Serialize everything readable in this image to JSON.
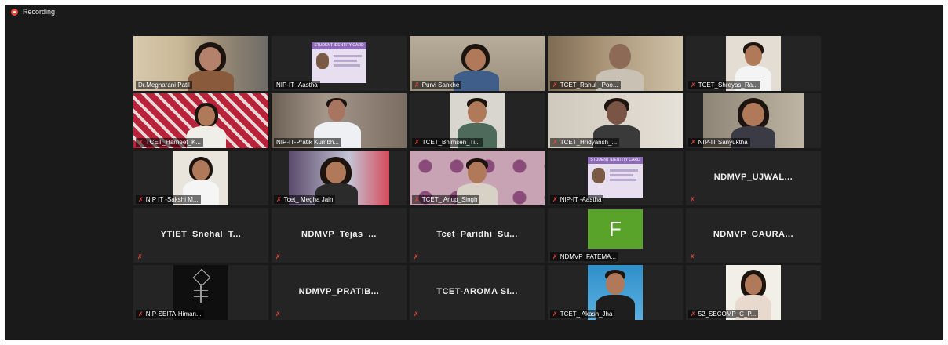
{
  "recording": {
    "label": "Recording"
  },
  "tiles": [
    {
      "name": "Dr.Megharani Patil",
      "muted": false,
      "active": true
    },
    {
      "name": "NIP-IT -Aastha",
      "muted": false
    },
    {
      "name": "Purvi Sankhe",
      "muted": true
    },
    {
      "name": "TCET_Rahul _Poo...",
      "muted": true
    },
    {
      "name": "TCET_Shreyas_Ra...",
      "muted": true
    },
    {
      "name": "TCET_Harneet_K...",
      "muted": true
    },
    {
      "name": "NIP-IT-Pratik Kumbh...",
      "muted": false
    },
    {
      "name": "TCET_Bhimsen_Ti...",
      "muted": true
    },
    {
      "name": "TCET_Hridyansh_...",
      "muted": true
    },
    {
      "name": "NIP-IT Sanyuktha",
      "muted": true
    },
    {
      "name": "NIP IT -Sakshi M...",
      "muted": true
    },
    {
      "name": "Tcet_ Megha Jain",
      "muted": true
    },
    {
      "name": "TCET_ Anup_Singh",
      "muted": true
    },
    {
      "name": "NIP-IT -Aastha",
      "muted": true
    },
    {
      "name": "NDMVP_UJWAL...",
      "muted": true
    },
    {
      "name": "YTIET_Snehal_T...",
      "muted": true
    },
    {
      "name": "NDMVP_Tejas_...",
      "muted": true
    },
    {
      "name": "Tcet_Paridhi_Su...",
      "muted": true
    },
    {
      "name": "NDMVP_FATEMA...",
      "muted": true,
      "avatar_letter": "F"
    },
    {
      "name": "NDMVP_GAURA...",
      "muted": true
    },
    {
      "name": "NIP-SEITA-Himan...",
      "muted": true
    },
    {
      "name": "NDMVP_PRATIB...",
      "muted": true
    },
    {
      "name": "TCET-AROMA SI...",
      "muted": true
    },
    {
      "name": "TCET_ Akash_Jha",
      "muted": true
    },
    {
      "name": "52_SECOMP_C_P...",
      "muted": true
    }
  ],
  "colors": {
    "active_border": "#c7d12f",
    "mic_muted": "#e8473a",
    "avatar_bg": "#5aa32a"
  }
}
